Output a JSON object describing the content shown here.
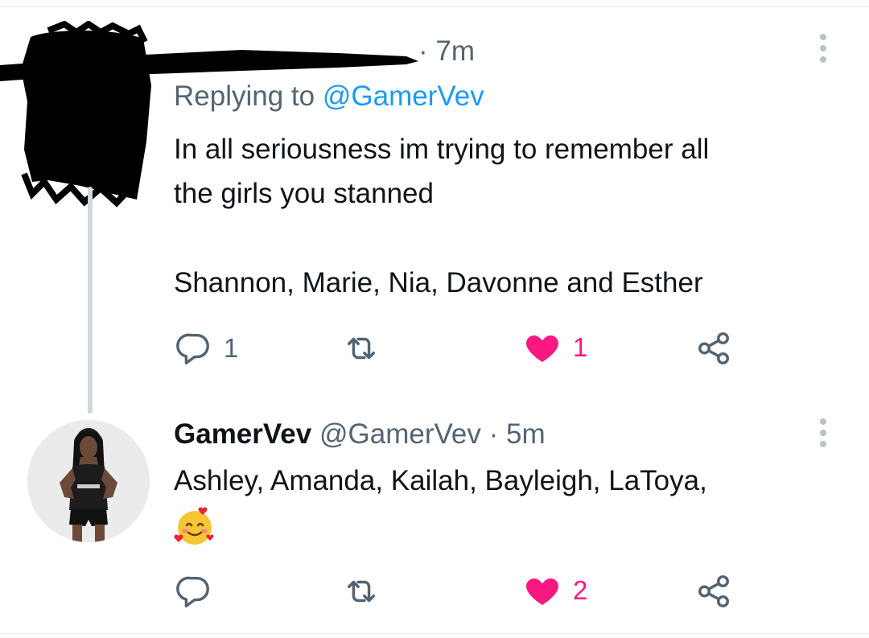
{
  "tweet1": {
    "time": "· 7m",
    "replying_prefix": "Replying to",
    "replying_handle": "@GamerVev",
    "text_line1": "In all seriousness im trying to remember all",
    "text_line2": "the girls you stanned",
    "text_line3": "Shannon, Marie, Nia, Davonne and Esther",
    "reply_count": "1",
    "retweet_count": "",
    "like_count": "1"
  },
  "tweet2": {
    "display_name": "GamerVev",
    "handle": "@GamerVev",
    "time": "· 5m",
    "text_line1": "Ashley, Amanda, Kailah, Bayleigh, LaToya,",
    "emoji": "smiling-face-with-hearts",
    "reply_count": "",
    "retweet_count": "",
    "like_count": "2"
  },
  "colors": {
    "text_primary": "#0f1419",
    "text_secondary": "#536471",
    "link": "#1d9bf0",
    "like_active": "#f91880",
    "thread_line": "#cfd9de"
  },
  "icons": [
    "reply-icon",
    "retweet-icon",
    "heart-icon",
    "share-icon",
    "more-icon"
  ]
}
